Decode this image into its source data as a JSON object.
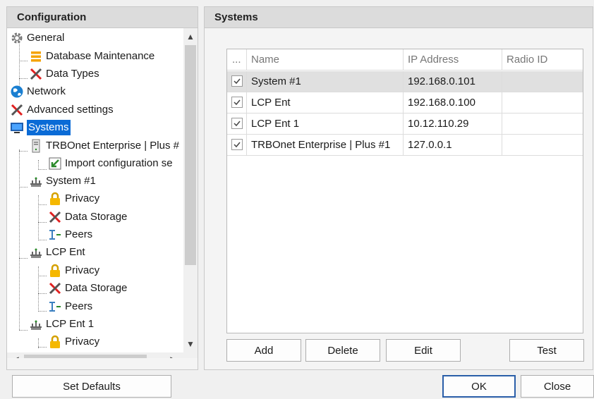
{
  "config_panel": {
    "title": "Configuration",
    "tree": [
      {
        "label": "General",
        "icon": "gear-icon"
      },
      {
        "label": "Database Maintenance",
        "icon": "database-icon"
      },
      {
        "label": "Data Types",
        "icon": "tools-icon"
      },
      {
        "label": "Network",
        "icon": "globe-icon"
      },
      {
        "label": "Advanced settings",
        "icon": "tools-icon"
      },
      {
        "label": "Systems",
        "icon": "monitor-icon",
        "selected": true
      },
      {
        "label": "TRBOnet Enterprise | Plus #",
        "icon": "server-icon"
      },
      {
        "label": "Import configuration se",
        "icon": "import-icon"
      },
      {
        "label": "System #1",
        "icon": "network-icon"
      },
      {
        "label": "Privacy",
        "icon": "lock-icon"
      },
      {
        "label": "Data Storage",
        "icon": "tools-icon"
      },
      {
        "label": "Peers",
        "icon": "peers-icon"
      },
      {
        "label": "LCP Ent",
        "icon": "network-icon"
      },
      {
        "label": "Privacy",
        "icon": "lock-icon"
      },
      {
        "label": "Data Storage",
        "icon": "tools-icon"
      },
      {
        "label": "Peers",
        "icon": "peers-icon"
      },
      {
        "label": "LCP Ent 1",
        "icon": "network-icon"
      },
      {
        "label": "Privacy",
        "icon": "lock-icon"
      }
    ]
  },
  "systems_panel": {
    "title": "Systems",
    "columns": [
      "...",
      "Name",
      "IP Address",
      "Radio ID"
    ],
    "rows": [
      {
        "checked": true,
        "name": "System #1",
        "ip": "192.168.0.101",
        "radio_id": ""
      },
      {
        "checked": true,
        "name": "LCP Ent",
        "ip": "192.168.0.100",
        "radio_id": ""
      },
      {
        "checked": true,
        "name": "LCP Ent 1",
        "ip": "10.12.110.29",
        "radio_id": ""
      },
      {
        "checked": true,
        "name": "TRBOnet Enterprise | Plus #1",
        "ip": "127.0.0.1",
        "radio_id": ""
      }
    ],
    "buttons": {
      "add": "Add",
      "delete": "Delete",
      "edit": "Edit",
      "test": "Test"
    }
  },
  "footer": {
    "set_defaults": "Set Defaults",
    "ok": "OK",
    "close": "Close"
  },
  "colors": {
    "selection": "#0a6bd6",
    "default_button_border": "#2a5ea8"
  }
}
